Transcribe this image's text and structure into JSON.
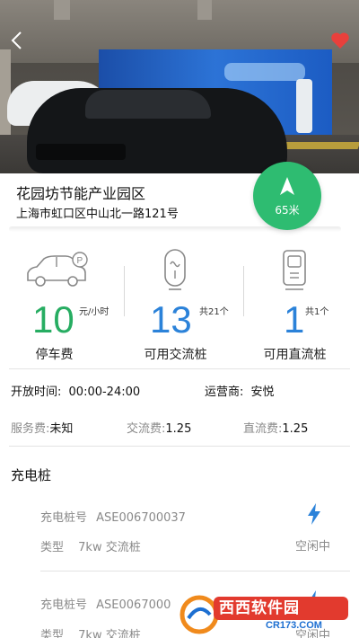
{
  "hero": {
    "back_icon": "chevron-left-icon",
    "favorite_icon": "heart-icon",
    "favorite_color": "#e8403c"
  },
  "station": {
    "name": "花园坊节能产业园区",
    "address": "上海市虹口区中山北一路121号",
    "distance": "65米",
    "nav_icon": "navigation-arrow-icon",
    "accent_color": "#2ebc71"
  },
  "stats": {
    "parking": {
      "value": "10",
      "unit": "元/小时",
      "label": "停车费",
      "color": "#27ad62",
      "icon": "parking-car-icon"
    },
    "ac": {
      "value": "13",
      "total": "共21个",
      "label": "可用交流桩",
      "color": "#2b82d9",
      "icon": "ac-charger-icon"
    },
    "dc": {
      "value": "1",
      "total": "共1个",
      "label": "可用直流桩",
      "color": "#2b82d9",
      "icon": "dc-charger-icon"
    }
  },
  "details": {
    "hours_label": "开放时间:",
    "hours_value": "00:00-24:00",
    "operator_label": "运营商:",
    "operator_value": "安悦",
    "service_fee_label": "服务费:",
    "service_fee_value": "未知",
    "ac_fee_label": "交流费:",
    "ac_fee_value": "1.25",
    "dc_fee_label": "直流费:",
    "dc_fee_value": "1.25"
  },
  "piles_section": {
    "title": "充电桩",
    "items": [
      {
        "no_label": "充电桩号",
        "no_value": "ASE006700037",
        "type_label": "类型",
        "type_value": "7kw 交流桩",
        "status": "空闲中",
        "icon": "lightning-bolt-icon"
      },
      {
        "no_label": "充电桩号",
        "no_value": "ASE0067000",
        "type_label": "类型",
        "type_value": "7kw 交流桩",
        "status": "空闲中",
        "icon": "lightning-bolt-icon"
      }
    ]
  },
  "watermark": {
    "brand": "西西软件园",
    "url": "CR173.COM"
  }
}
